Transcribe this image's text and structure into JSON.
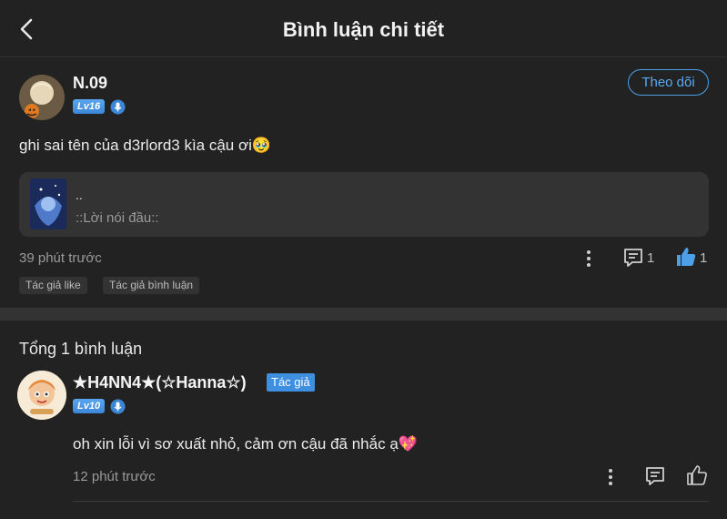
{
  "header": {
    "title": "Bình luận chi tiết"
  },
  "comment": {
    "username": "N.09",
    "level": "Lv16",
    "follow_label": "Theo dõi",
    "text": "ghi sai tên của d3rlord3 kìa cậu ơi🥹",
    "quote": {
      "line1": "..",
      "line2": "::Lời nói đầu::"
    },
    "time": "39 phút trước",
    "reply_count": "1",
    "like_count": "1",
    "tags": [
      "Tác giả like",
      "Tác giả bình luận"
    ]
  },
  "replies_section": {
    "total_label": "Tổng 1 bình luận"
  },
  "reply": {
    "username": "★H4NN4★(☆Hanna☆)",
    "author_tag": "Tác giả",
    "level": "Lv10",
    "text": "oh xin lỗi vì sơ xuất nhỏ, cảm ơn cậu đã nhắc ạ💖",
    "time": "12 phút trước"
  },
  "colors": {
    "accent": "#4d9fe8",
    "background": "#222222",
    "panel": "#333333",
    "muted": "#9a9a9a"
  },
  "icons": [
    "back-arrow-icon",
    "mic-badge-icon",
    "more-vertical-icon",
    "comment-icon",
    "thumbs-up-icon"
  ]
}
